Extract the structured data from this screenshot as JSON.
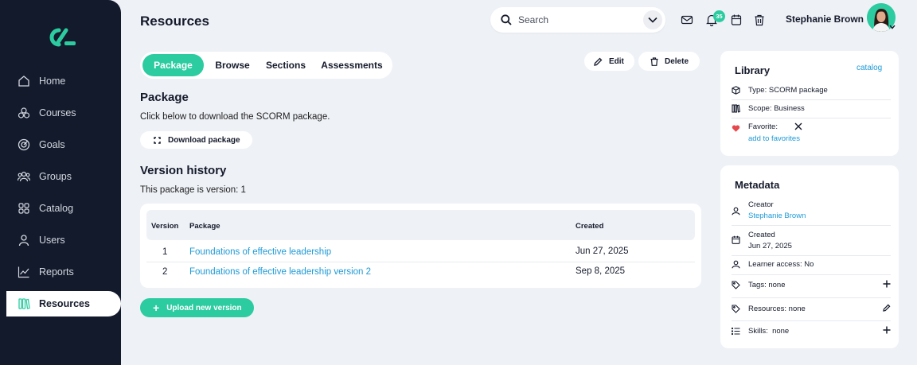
{
  "app": {
    "title": "Resources"
  },
  "sidebar": {
    "items": [
      {
        "label": "Home",
        "icon": "home-icon"
      },
      {
        "label": "Courses",
        "icon": "courses-icon"
      },
      {
        "label": "Goals",
        "icon": "target-icon"
      },
      {
        "label": "Groups",
        "icon": "groups-icon"
      },
      {
        "label": "Catalog",
        "icon": "catalog-icon"
      },
      {
        "label": "Users",
        "icon": "user-icon"
      },
      {
        "label": "Reports",
        "icon": "chart-icon"
      },
      {
        "label": "Resources",
        "icon": "resources-icon",
        "active": true
      }
    ]
  },
  "header": {
    "search_placeholder": "Search",
    "notification_count": "35",
    "user_name": "Stephanie Brown"
  },
  "tabs": [
    {
      "label": "Package",
      "active": true
    },
    {
      "label": "Browse"
    },
    {
      "label": "Sections"
    },
    {
      "label": "Assessments"
    }
  ],
  "actions": {
    "edit_label": "Edit",
    "delete_label": "Delete"
  },
  "package": {
    "heading": "Package",
    "description": "Click below to download the SCORM package.",
    "download_label": "Download package"
  },
  "version_history": {
    "heading": "Version history",
    "current_text": "This package is version: 1",
    "columns": {
      "version": "Version",
      "package": "Package",
      "created": "Created"
    },
    "rows": [
      {
        "version": "1",
        "package": "Foundations of effective leadership",
        "created": "Jun 27, 2025"
      },
      {
        "version": "2",
        "package": "Foundations of effective leadership version 2",
        "created": "Sep 8, 2025"
      }
    ],
    "upload_label": "Upload new version"
  },
  "library": {
    "title": "Library",
    "link": "catalog",
    "type": "Type: SCORM package",
    "scope": "Scope: Business",
    "favorite_label": "Favorite:",
    "favorite_link": "add to favorites"
  },
  "metadata": {
    "title": "Metadata",
    "creator_label": "Creator",
    "creator_value": "Stephanie Brown",
    "created_label": "Created",
    "created_value": "Jun 27, 2025",
    "learner_access": "Learner access: No",
    "tags": "Tags: none",
    "resources": "Resources: none",
    "skills": "Skills:  none"
  },
  "colors": {
    "accent": "#2ccba0",
    "sidebar": "#131a2b",
    "link": "#1e9ad6",
    "background": "#eef1f6",
    "favorite": "#e5484d"
  }
}
